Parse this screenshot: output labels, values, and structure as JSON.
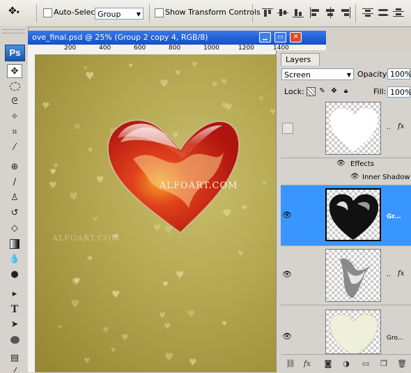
{
  "options_bar": {
    "auto_select_label": "Auto-Select:",
    "auto_select_value": "Group",
    "show_transform_label": "Show Transform Controls"
  },
  "app_logo": "Ps",
  "document": {
    "title": "ove_final.psd @ 25% (Group 2 copy 4, RGB/8)",
    "ruler_labels": [
      "200",
      "400",
      "600",
      "800",
      "1000",
      "1200",
      "1400"
    ]
  },
  "canvas": {
    "watermark_main": "ALFOART.COM",
    "watermark_secondary": "ALFOART.COM",
    "colors": {
      "background": "#b4a64f",
      "heart_red": "#d8281a",
      "heart_orange": "#f0a020"
    }
  },
  "layers_panel": {
    "tab_label": "Layers",
    "close_label": "×",
    "blend_mode": "Screen",
    "opacity_label": "Opacity:",
    "opacity_value": "100%",
    "lock_label": "Lock:",
    "fill_label": "Fill:",
    "fill_value": "100%",
    "layers": [
      {
        "name": "..",
        "fx": "fx",
        "visible": false,
        "selected": false
      },
      {
        "name": "Gr...",
        "fx": "",
        "visible": true,
        "selected": true
      },
      {
        "name": "..",
        "fx": "fx",
        "visible": true,
        "selected": false
      },
      {
        "name": "Gro...",
        "fx": "",
        "visible": true,
        "selected": false
      }
    ],
    "effects_label": "Effects",
    "inner_shadow_label": "Inner Shadow",
    "accent_color": "#3a96ff"
  },
  "icons": {
    "footer": [
      "link-icon",
      "fx-icon",
      "mask-icon",
      "adjustment-icon",
      "folder-icon",
      "new-layer-icon",
      "trash-icon"
    ]
  }
}
